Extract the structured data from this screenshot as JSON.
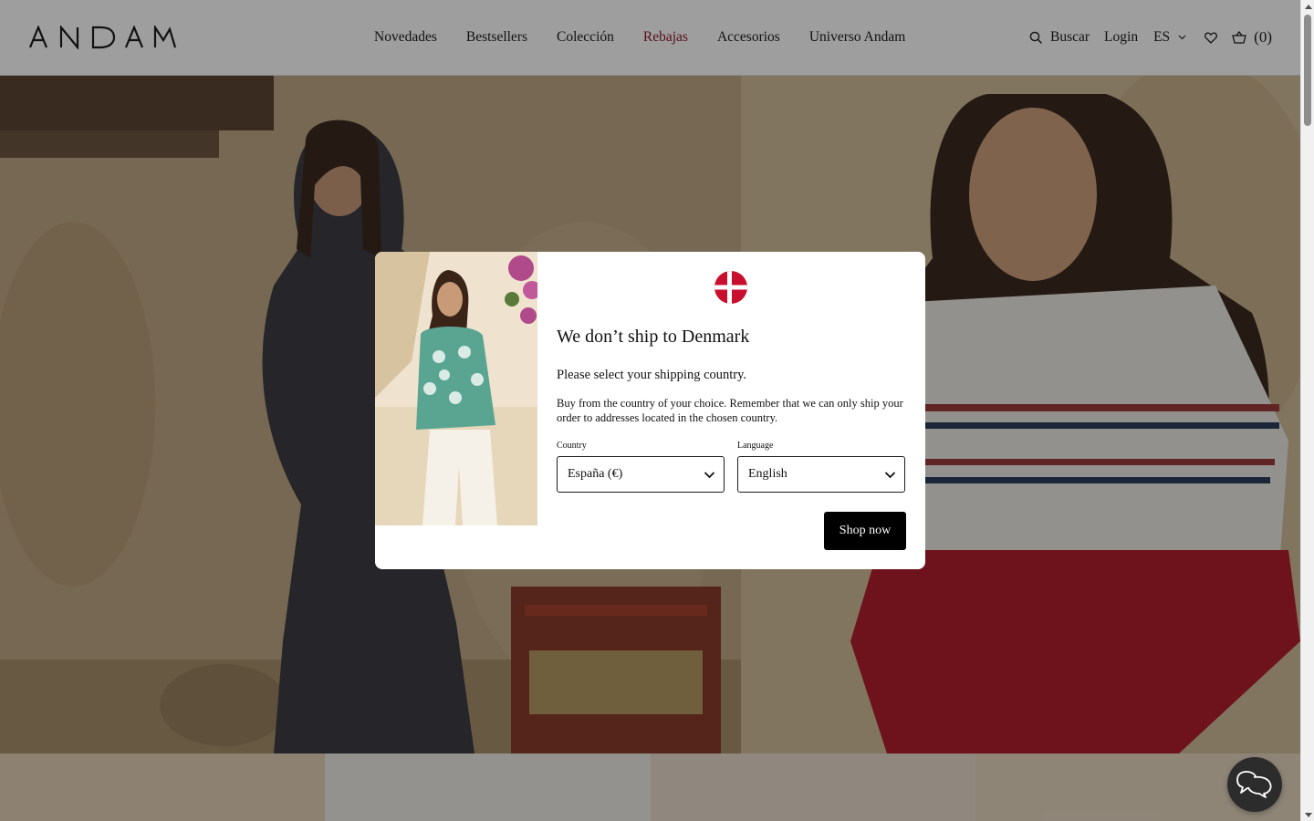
{
  "header": {
    "logo_text": "ANDAM",
    "nav": [
      {
        "label": "Novedades"
      },
      {
        "label": "Bestsellers"
      },
      {
        "label": "Colección"
      },
      {
        "label": "Rebajas"
      },
      {
        "label": "Accesorios"
      },
      {
        "label": "Universo Andam"
      }
    ],
    "search_label": "Buscar",
    "login_label": "Login",
    "language_label": "ES",
    "cart_count": "(0)",
    "icons": [
      "search-icon",
      "chevron-down-icon",
      "heart-icon",
      "basket-icon"
    ]
  },
  "modal": {
    "flag": "denmark-flag-icon",
    "title": "We don’t ship to Denmark",
    "lead": "Please select your shipping country.",
    "description": "Buy from the country of your choice. Remember that we can only ship your order to addresses located in the chosen country.",
    "country_label": "Country",
    "country_value": "España (€)",
    "language_label": "Language",
    "language_value": "English",
    "shop_button": "Shop now"
  },
  "colors": {
    "accent_sale": "#8c1c2b",
    "button_bg": "#000000",
    "flag_red": "#c8102e"
  },
  "chat": {
    "icon": "chat-bubble-icon"
  }
}
